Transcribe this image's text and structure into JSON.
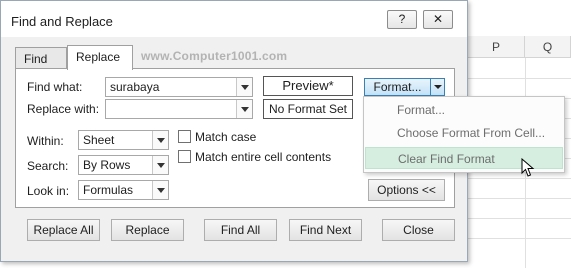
{
  "window": {
    "title": "Find and Replace",
    "help_label": "?",
    "close_label": "✕"
  },
  "sheet": {
    "col_p": "P",
    "col_q": "Q"
  },
  "tabs": {
    "find": "Find",
    "replace": "Replace"
  },
  "watermark": "www.Computer1001.com",
  "find_what": {
    "label": "Find what:",
    "value": "surabaya",
    "preview": "Preview*"
  },
  "replace_with": {
    "label": "Replace with:",
    "value": "",
    "preview": "No Format Set"
  },
  "format_button": {
    "label": "Format..."
  },
  "format_menu": {
    "items": [
      "Format...",
      "Choose Format From Cell...",
      "Clear Find Format"
    ],
    "highlighted": "Clear Find Format"
  },
  "within": {
    "label": "Within:",
    "value": "Sheet"
  },
  "search": {
    "label": "Search:",
    "value": "By Rows"
  },
  "look_in": {
    "label": "Look in:",
    "value": "Formulas"
  },
  "options": {
    "match_case": "Match case",
    "match_entire": "Match entire cell contents",
    "match_case_checked": false,
    "match_entire_checked": false
  },
  "options_button": "Options <<",
  "buttons": {
    "replace_all": "Replace All",
    "replace": "Replace",
    "find_all": "Find All",
    "find_next": "Find Next",
    "close": "Close"
  },
  "colors": {
    "accent": "#3c7fb1",
    "menu_highlight": "#d5eee0"
  }
}
